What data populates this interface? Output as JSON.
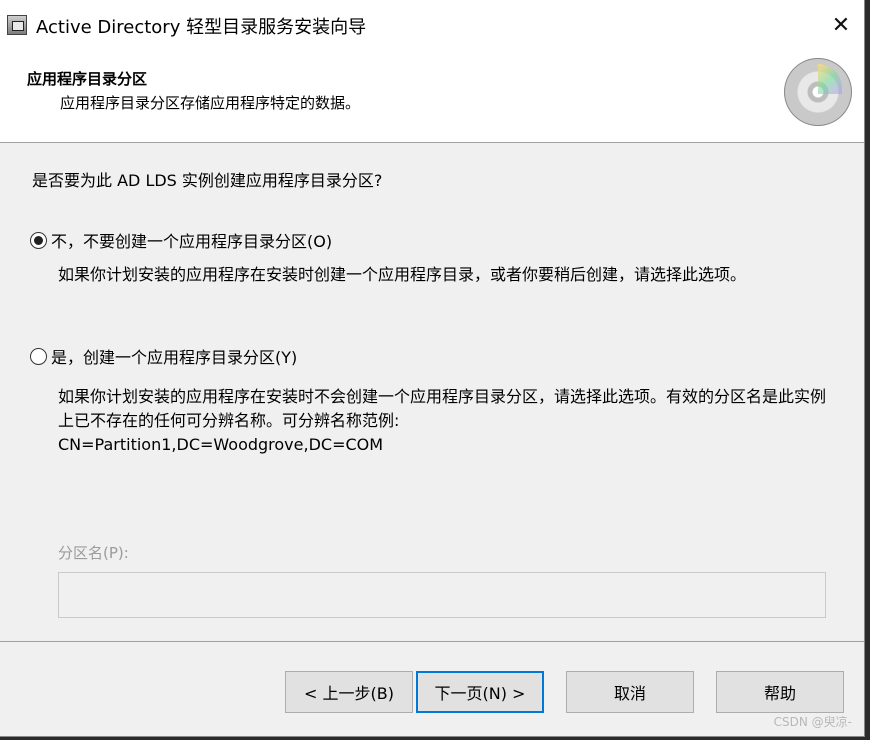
{
  "window": {
    "title": "Active Directory 轻型目录服务安装向导",
    "close_glyph": "✕"
  },
  "header": {
    "title": "应用程序目录分区",
    "subtitle": "应用程序目录分区存储应用程序特定的数据。",
    "icon": "cd-disc-icon"
  },
  "main": {
    "question": "是否要为此 AD LDS 实例创建应用程序目录分区?",
    "options": [
      {
        "label": "不，不要创建一个应用程序目录分区(O)",
        "checked": true,
        "description": "如果你计划安装的应用程序在安装时创建一个应用程序目录，或者你要稍后创建，请选择此选项。"
      },
      {
        "label": "是，创建一个应用程序目录分区(Y)",
        "checked": false,
        "description": "如果你计划安装的应用程序在安装时不会创建一个应用程序目录分区，请选择此选项。有效的分区名是此实例上已不存在的任何可分辨名称。可分辨名称范例:",
        "example": "CN=Partition1,DC=Woodgrove,DC=COM"
      }
    ],
    "partition_field": {
      "label": "分区名(P):",
      "value": "",
      "enabled": false
    }
  },
  "footer": {
    "back": "< 上一步(B)",
    "next": "下一页(N) >",
    "cancel": "取消",
    "help": "帮助"
  },
  "watermark": "CSDN @臾凉-",
  "colors": {
    "dialog_bg": "#f0f0f0",
    "header_bg": "#ffffff",
    "default_button_border": "#0078d7",
    "disabled_text": "#9b9b9b"
  }
}
